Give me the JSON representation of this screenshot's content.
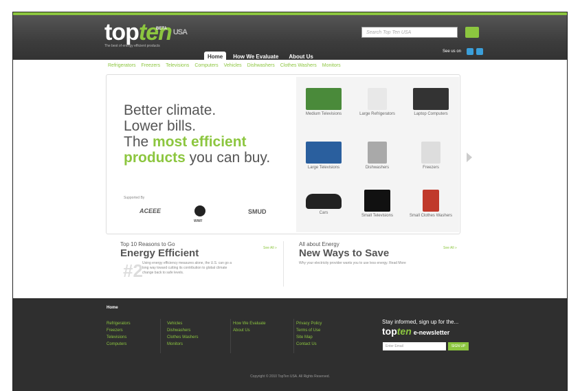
{
  "header": {
    "logo_top": "top",
    "logo_ten": "ten",
    "logo_usa": "USA",
    "logo_beta": "BETA",
    "tagline": "The best of energy efficient products",
    "search_placeholder": "Search Top Ten USA",
    "see_us_on": "See us on",
    "nav": [
      "Home",
      "How We Evaluate",
      "About Us"
    ]
  },
  "subnav": [
    "Refrigerators",
    "Freezers",
    "Televisions",
    "Computers",
    "Vehicles",
    "Dishwashers",
    "Clothes Washers",
    "Monitors"
  ],
  "hero": {
    "line1": "Better climate.",
    "line2": "Lower bills.",
    "line3_pre": "The ",
    "line3_green": "most efficient",
    "line4_green": "products",
    "line4_post": " you can buy.",
    "supported_by": "Supported By",
    "sponsors": [
      "ACEEE",
      "WWF",
      "SMUD"
    ]
  },
  "grid": [
    {
      "label": "Medium Televisions",
      "color": "#4a8a3a"
    },
    {
      "label": "Large Refrigerators",
      "color": "#e8e8e8"
    },
    {
      "label": "Laptop Computers",
      "color": "#333333"
    },
    {
      "label": "Large Televisions",
      "color": "#2a5f9e"
    },
    {
      "label": "Dishwashers",
      "color": "#a9a9a9"
    },
    {
      "label": "Freezers",
      "color": "#dddddd"
    },
    {
      "label": "Cars",
      "color": "#222222"
    },
    {
      "label": "Small Televisions",
      "color": "#111111"
    },
    {
      "label": "Small Clothes Washers",
      "color": "#c0392b"
    }
  ],
  "promos": {
    "left_small": "Top 10 Reasons to Go",
    "left_big": "Energy Efficient",
    "left_seeall": "See All »",
    "left_num": "#2",
    "left_desc": "Using energy efficiency measures alone, the U.S. can go a long way toward cutting its contribution to global climate change back to safe levels.",
    "right_small": "All about Energy",
    "right_big": "New Ways to Save",
    "right_seeall": "See All »",
    "right_desc": "Why your electricity provider wants you to use less energy. Read More"
  },
  "footer": {
    "home": "Home",
    "col1": [
      "Refrigerators",
      "Freezers",
      "Televisions",
      "Computers"
    ],
    "col2": [
      "Vehicles",
      "Dishwashers",
      "Clothes Washers",
      "Monitors"
    ],
    "col3": [
      "How We Evaluate",
      "About Us"
    ],
    "col4": [
      "Privacy Policy",
      "Terms of Use",
      "Site Map",
      "Contact Us"
    ],
    "news_title": "Stay informed, sign up for the...",
    "news_top": "top",
    "news_ten": "ten",
    "news_label": "e-newsletter",
    "email_placeholder": "Enter Email",
    "submit": "SIGN UP",
    "copyright": "Copyright © 2010 TopTen USA. All Rights Reserved."
  },
  "colors": {
    "accent": "#8cc63f",
    "header": "#3c3c3c",
    "footer": "#2f2f2f"
  }
}
